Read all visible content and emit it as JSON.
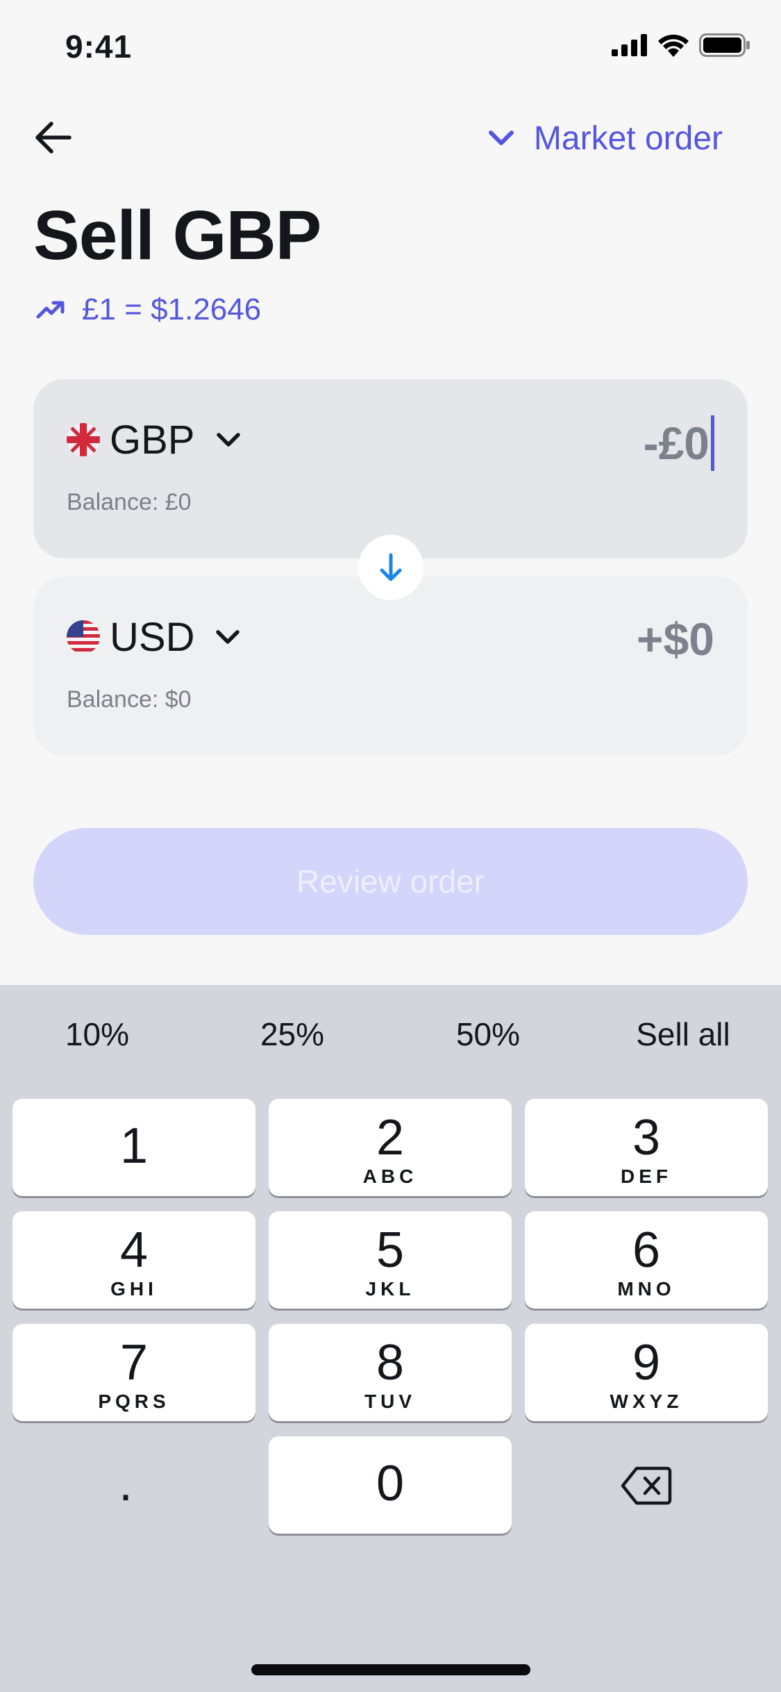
{
  "status_bar": {
    "time": "9:41"
  },
  "header": {
    "order_type": "Market order",
    "title": "Sell GBP",
    "rate": "£1 = $1.2646"
  },
  "from": {
    "currency": "GBP",
    "amount": "-£0",
    "balance": "Balance: £0"
  },
  "to": {
    "currency": "USD",
    "amount": "+$0",
    "balance": "Balance: $0"
  },
  "review_button": {
    "label": "Review order"
  },
  "quick_amounts": [
    "10%",
    "25%",
    "50%",
    "Sell all"
  ],
  "keypad": [
    {
      "num": "1",
      "letters": ""
    },
    {
      "num": "2",
      "letters": "ABC"
    },
    {
      "num": "3",
      "letters": "DEF"
    },
    {
      "num": "4",
      "letters": "GHI"
    },
    {
      "num": "5",
      "letters": "JKL"
    },
    {
      "num": "6",
      "letters": "MNO"
    },
    {
      "num": "7",
      "letters": "PQRS"
    },
    {
      "num": "8",
      "letters": "TUV"
    },
    {
      "num": "9",
      "letters": "WXYZ"
    },
    {
      "num": ".",
      "letters": ""
    },
    {
      "num": "0",
      "letters": ""
    }
  ],
  "colors": {
    "accent": "#5456e0",
    "swap_arrow": "#1a86e8",
    "button_disabled": "#d3d5fb"
  }
}
